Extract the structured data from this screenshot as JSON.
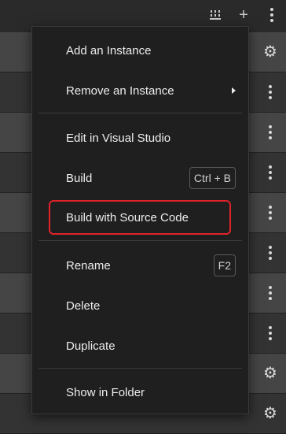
{
  "toolbar": {
    "icons": [
      "grid-icon",
      "plus-icon",
      "more-vertical-icon"
    ],
    "plus_glyph": "+"
  },
  "rows": {
    "icons": [
      "gear-icon",
      "more-vertical-icon",
      "more-vertical-icon",
      "more-vertical-icon",
      "more-vertical-icon",
      "more-vertical-icon",
      "more-vertical-icon",
      "more-vertical-icon",
      "gear-icon",
      "gear-icon"
    ],
    "gear_glyph": "⚙"
  },
  "menu": {
    "add_instance": "Add an Instance",
    "remove_instance": "Remove an Instance",
    "edit_in_vs": "Edit in Visual Studio",
    "build": "Build",
    "build_shortcut": "Ctrl + B",
    "build_with_source": "Build with Source Code",
    "rename": "Rename",
    "rename_shortcut": "F2",
    "delete": "Delete",
    "duplicate": "Duplicate",
    "show_in_folder": "Show in Folder"
  },
  "colors": {
    "highlight": "#e0222b",
    "menu_bg": "#1f1f1f",
    "row_light": "#454545",
    "row_dark": "#333333"
  }
}
